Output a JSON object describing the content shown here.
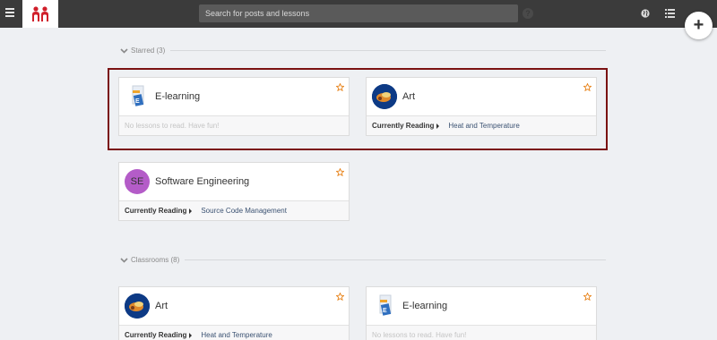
{
  "topbar": {
    "search_placeholder": "Search for posts and lessons",
    "help_glyph": "?",
    "add_glyph": "+"
  },
  "colors": {
    "topbar": "#3b3b3b",
    "logo_red": "#d01f2a",
    "star_orange": "#e8841c",
    "highlight_border": "#7a1212",
    "se_avatar": "#b45cc8"
  },
  "starred": {
    "header": "Starred (3)",
    "cards": [
      {
        "title": "E-learning",
        "icon": "elearning-icon",
        "empty_message": "No lessons to read. Have fun!"
      },
      {
        "title": "Art",
        "icon": "art-avatar",
        "reading_label": "Currently Reading",
        "reading_value": "Heat and Temperature"
      },
      {
        "title": "Software Engineering",
        "avatar_text": "SE",
        "reading_label": "Currently Reading",
        "reading_value": "Source Code Management"
      }
    ]
  },
  "classrooms": {
    "header": "Classrooms (8)",
    "cards": [
      {
        "title": "Art",
        "icon": "art-avatar",
        "reading_label": "Currently Reading",
        "reading_value": "Heat and Temperature"
      },
      {
        "title": "E-learning",
        "icon": "elearning-icon",
        "empty_message": "No lessons to read. Have fun!"
      }
    ]
  }
}
